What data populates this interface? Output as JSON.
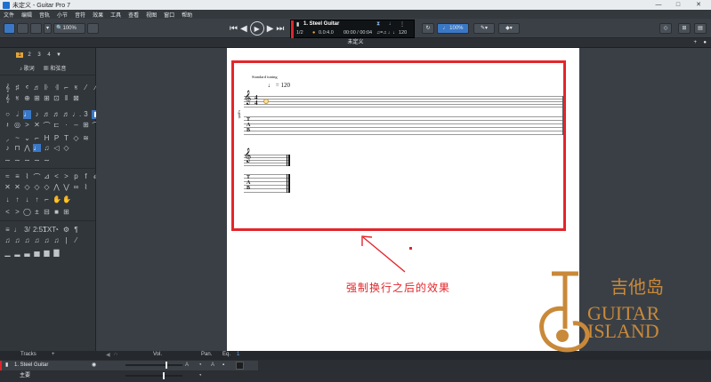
{
  "window": {
    "title": "未定义 - Guitar Pro 7",
    "controls": [
      "—",
      "□",
      "✕"
    ]
  },
  "menu": [
    "文件",
    "编辑",
    "音轨",
    "小节",
    "音符",
    "效果",
    "工具",
    "查看",
    "视图",
    "窗口",
    "帮助"
  ],
  "toolbar": {
    "zoom": "100%",
    "lcd": {
      "track_name": "1. Steel Guitar",
      "page": "1/2",
      "position": "0.0:4.0",
      "time": "00:00 / 00:04",
      "tempo": "120"
    },
    "speed": "100%"
  },
  "tab": {
    "title": "未定义"
  },
  "left_panel": {
    "voices": [
      "1",
      "2",
      "3",
      "4"
    ],
    "lyrics_button": "歌词",
    "chord_button": "和弦音"
  },
  "score": {
    "tuning": "Standard tuning",
    "tempo": "= 120",
    "tab_label": "T\nA\nB"
  },
  "annotation": {
    "caption": "强制换行之后的效果",
    "highlight_color": "#e3262b"
  },
  "tracks": {
    "header": {
      "tracks": "Tracks",
      "vol": "Vol.",
      "pan": "Pan.",
      "eq": "Eq."
    },
    "rows": [
      {
        "name": "1. Steel Guitar"
      },
      {
        "name": "主要"
      }
    ]
  },
  "watermark": {
    "cn": "吉他岛",
    "en1": "GUITAR",
    "en2": "ISLAND",
    "color": "#c9893a"
  }
}
